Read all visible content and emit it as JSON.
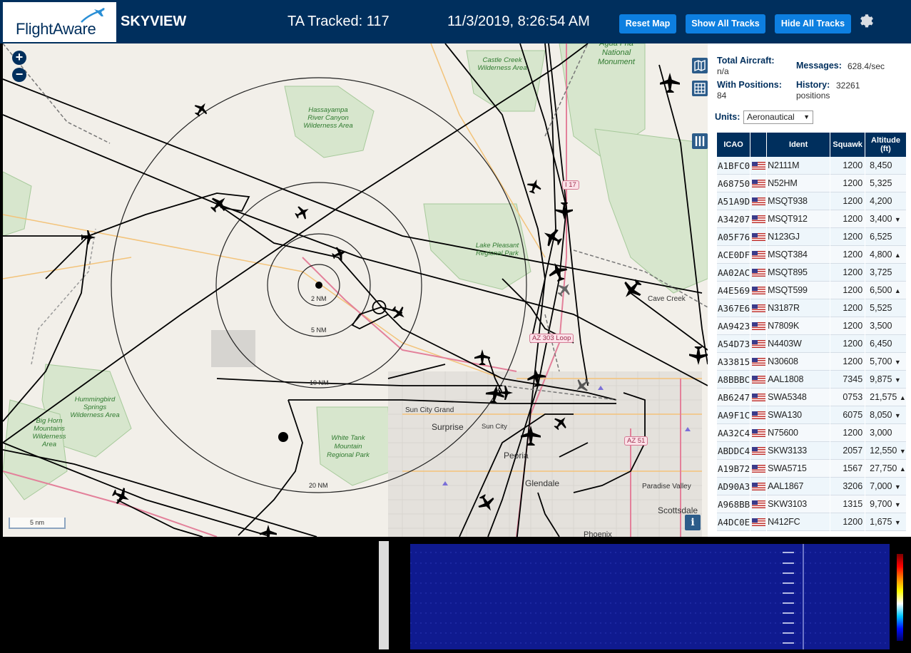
{
  "header": {
    "logo_text": "FlightAware",
    "app_name": "SKYVIEW",
    "ta_tracked": "TA Tracked: 117",
    "datetime": "11/3/2019, 8:26:54 AM",
    "buttons": {
      "reset_map": "Reset Map",
      "show_all_tracks": "Show All Tracks",
      "hide_all_tracks": "Hide All Tracks"
    },
    "settings_icon": "gear-icon"
  },
  "map": {
    "zoom_in": "+",
    "zoom_out": "−",
    "range_rings": [
      "2 NM",
      "5 NM",
      "10 NM",
      "20 NM"
    ],
    "scale": "5 nm",
    "labels": {
      "castle_creek": "Castle Creek Wilderness Area",
      "hassayampa": "Hassayampa River Canyon Wilderness Area",
      "lake_pleasant": "Lake Pleasant Regional Park",
      "hummingbird": "Hummingbird Springs Wilderness Area",
      "big_horn": "Big Horn Mountains Wilderness Area",
      "white_tank": "White Tank Mountain Regional Park",
      "national_monument": "Agua Fria National Monument",
      "sun_city_grand": "Sun City Grand",
      "surprise": "Surprise",
      "sun_city": "Sun City",
      "peoria": "Peoria",
      "glendale": "Glendale",
      "paradise_valley": "Paradise Valley",
      "scottsdale": "Scottsdale",
      "cave_creek": "Cave Creek",
      "phoenix": "Phoenix",
      "shield_17": "I 17",
      "shield_303": "AZ 303 Loop",
      "shield_51": "AZ 51"
    },
    "controls": [
      "map-icon",
      "grid-icon",
      "columns-icon"
    ],
    "info": "i"
  },
  "stats": {
    "total_aircraft_label": "Total Aircraft:",
    "total_aircraft_value": "n/a",
    "with_positions_label": "With Positions:",
    "with_positions_value": "84",
    "messages_label": "Messages:",
    "messages_value": "628.4/sec",
    "history_label": "History:",
    "history_value": "32261",
    "history_unit": "positions",
    "units_label": "Units:",
    "units_value": "Aeronautical"
  },
  "table": {
    "headers": [
      "ICAO",
      "",
      "Ident",
      "Squawk",
      "Altitude (ft)"
    ],
    "rows": [
      {
        "icao": "A1BFC0",
        "ident": "N2111M",
        "squawk": "1200",
        "alt": "8,450",
        "trend": ""
      },
      {
        "icao": "A68750",
        "ident": "N52HM",
        "squawk": "1200",
        "alt": "5,325",
        "trend": ""
      },
      {
        "icao": "A51A9D",
        "ident": "MSQT938",
        "squawk": "1200",
        "alt": "4,200",
        "trend": ""
      },
      {
        "icao": "A34207",
        "ident": "MSQT912",
        "squawk": "1200",
        "alt": "3,400",
        "trend": "▼"
      },
      {
        "icao": "A05F76",
        "ident": "N123GJ",
        "squawk": "1200",
        "alt": "6,525",
        "trend": ""
      },
      {
        "icao": "ACE0DF",
        "ident": "MSQT384",
        "squawk": "1200",
        "alt": "4,800",
        "trend": "▲"
      },
      {
        "icao": "AA02AC",
        "ident": "MSQT895",
        "squawk": "1200",
        "alt": "3,725",
        "trend": ""
      },
      {
        "icao": "A4E569",
        "ident": "MSQT599",
        "squawk": "1200",
        "alt": "6,500",
        "trend": "▲"
      },
      {
        "icao": "A367E6",
        "ident": "N3187R",
        "squawk": "1200",
        "alt": "5,525",
        "trend": ""
      },
      {
        "icao": "AA9423",
        "ident": "N7809K",
        "squawk": "1200",
        "alt": "3,500",
        "trend": ""
      },
      {
        "icao": "A54D73",
        "ident": "N4403W",
        "squawk": "1200",
        "alt": "6,450",
        "trend": ""
      },
      {
        "icao": "A33815",
        "ident": "N30608",
        "squawk": "1200",
        "alt": "5,700",
        "trend": "▼"
      },
      {
        "icao": "A8BBBC",
        "ident": "AAL1808",
        "squawk": "7345",
        "alt": "9,875",
        "trend": "▼"
      },
      {
        "icao": "AB6247",
        "ident": "SWA5348",
        "squawk": "0753",
        "alt": "21,575",
        "trend": "▲"
      },
      {
        "icao": "AA9F1C",
        "ident": "SWA130",
        "squawk": "6075",
        "alt": "8,050",
        "trend": "▼"
      },
      {
        "icao": "AA32C4",
        "ident": "N75600",
        "squawk": "1200",
        "alt": "3,000",
        "trend": ""
      },
      {
        "icao": "ABDDC4",
        "ident": "SKW3133",
        "squawk": "2057",
        "alt": "12,550",
        "trend": "▼"
      },
      {
        "icao": "A19B72",
        "ident": "SWA5715",
        "squawk": "1567",
        "alt": "27,750",
        "trend": "▲"
      },
      {
        "icao": "AD90A3",
        "ident": "AAL1867",
        "squawk": "3206",
        "alt": "7,000",
        "trend": "▼"
      },
      {
        "icao": "A968BB",
        "ident": "SKW3103",
        "squawk": "1315",
        "alt": "9,700",
        "trend": "▼"
      },
      {
        "icao": "A4DC0E",
        "ident": "N412FC",
        "squawk": "1200",
        "alt": "1,675",
        "trend": "▼"
      }
    ]
  },
  "colors": {
    "header_bg": "#002f5d",
    "button_bg": "#0d7fe0",
    "map_bg": "#f2efe9",
    "spectrogram_bg": "#0f1a8f"
  }
}
